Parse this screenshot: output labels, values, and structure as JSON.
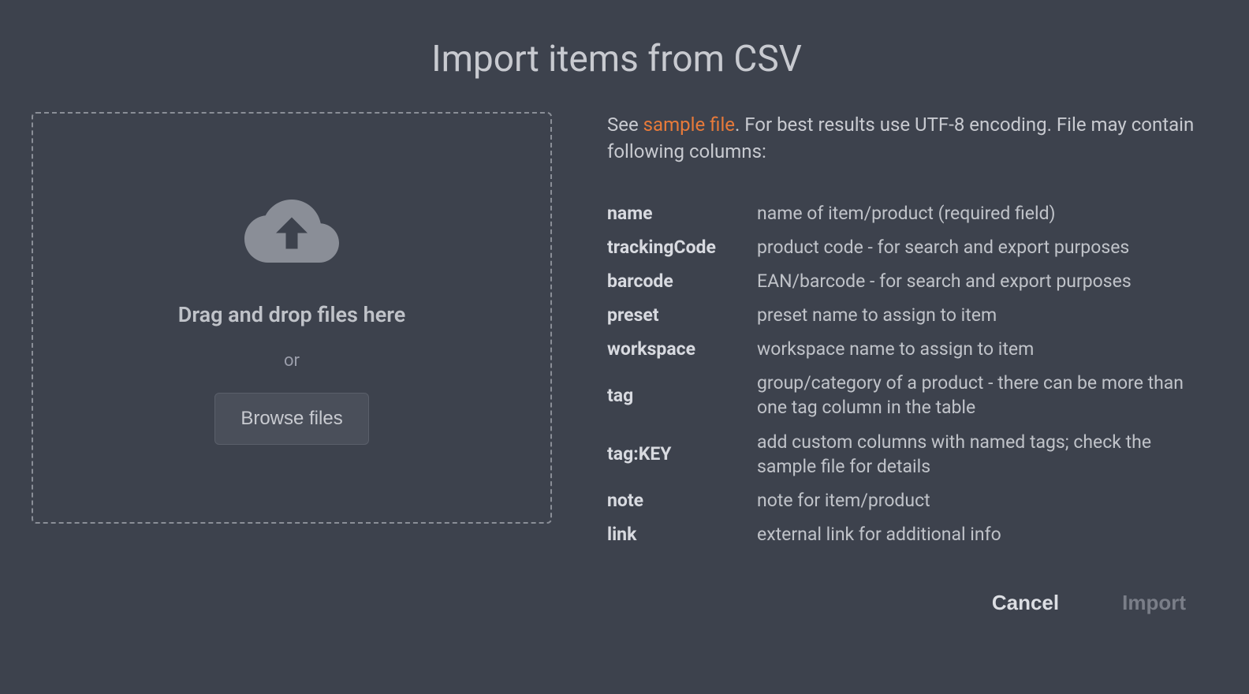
{
  "title": "Import items from CSV",
  "dropzone": {
    "dragText": "Drag and drop files here",
    "orText": "or",
    "browseLabel": "Browse files"
  },
  "intro": {
    "prefix": "See ",
    "sampleLinkText": "sample file",
    "suffix": ". For best results use UTF-8 encoding. File may contain following columns:"
  },
  "columns": [
    {
      "key": "name",
      "desc": "name of item/product (required field)"
    },
    {
      "key": "trackingCode",
      "desc": "product code - for search and export purposes"
    },
    {
      "key": "barcode",
      "desc": "EAN/barcode - for search and export purposes"
    },
    {
      "key": "preset",
      "desc": "preset name to assign to item"
    },
    {
      "key": "workspace",
      "desc": "workspace name to assign to item"
    },
    {
      "key": "tag",
      "desc": "group/category of a product - there can be more than one tag column in the table"
    },
    {
      "key": "tag:KEY",
      "desc": "add custom columns with named tags; check the sample file for details"
    },
    {
      "key": "note",
      "desc": "note for item/product"
    },
    {
      "key": "link",
      "desc": "external link for additional info"
    }
  ],
  "footer": {
    "cancel": "Cancel",
    "import": "Import"
  }
}
